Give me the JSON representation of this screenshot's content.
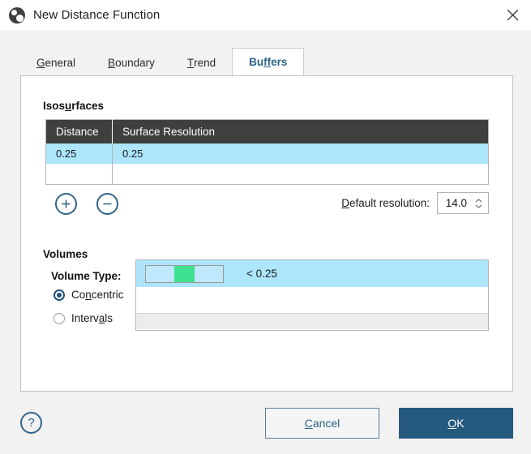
{
  "window": {
    "title": "New Distance Function",
    "app_icon": "app-logo-icon",
    "close_icon": "close-icon"
  },
  "tabs": [
    {
      "label": "General",
      "accel": "G",
      "active": false
    },
    {
      "label": "Boundary",
      "accel": "B",
      "active": false
    },
    {
      "label": "Trend",
      "accel": "T",
      "active": false
    },
    {
      "label": "Buffers",
      "accel": "ff",
      "active": true
    }
  ],
  "isosurfaces": {
    "title": "Isosurfaces",
    "title_accel": "u",
    "columns": [
      "Distance",
      "Surface Resolution"
    ],
    "rows": [
      {
        "distance": "0.25",
        "surface_resolution": "0.25",
        "selected": true
      },
      {
        "distance": "",
        "surface_resolution": "",
        "selected": false
      }
    ],
    "add_button": "add-isosurface-button",
    "remove_button": "remove-isosurface-button",
    "default_resolution": {
      "label": "Default resolution:",
      "accel": "D",
      "value": "14.0"
    }
  },
  "volumes": {
    "title": "Volumes",
    "volume_type_label": "Volume Type:",
    "options": [
      {
        "label": "Concentric",
        "accel": "n",
        "selected": true
      },
      {
        "label": "Intervals",
        "accel": "a",
        "selected": false
      }
    ],
    "rows": [
      {
        "color": "#3fe08f",
        "label": "< 0.25",
        "selected": true
      }
    ]
  },
  "footer": {
    "help_label": "?",
    "cancel_label": "Cancel",
    "cancel_accel": "C",
    "ok_label": "OK",
    "ok_accel": "O"
  },
  "colors": {
    "accent": "#25597e",
    "tab_active": "#2a6487",
    "selection": "#ade5fa",
    "header": "#3f3f3f",
    "swatch_green": "#3fe08f"
  }
}
